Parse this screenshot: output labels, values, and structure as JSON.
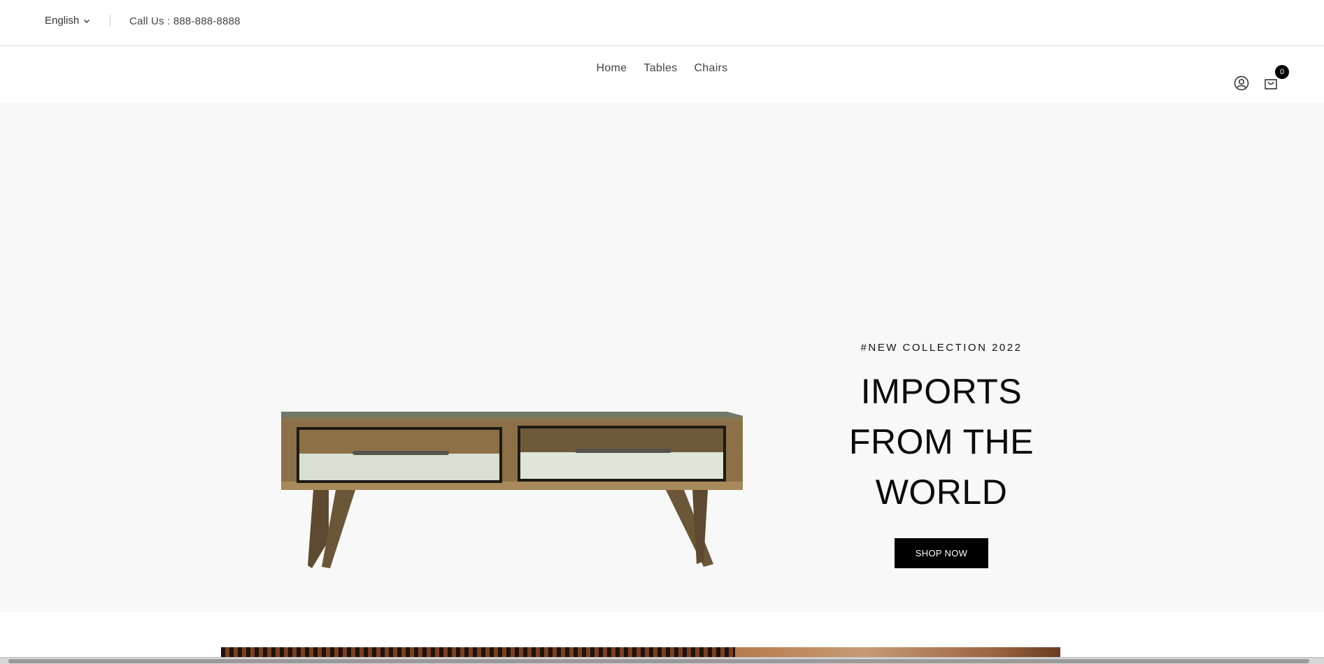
{
  "topbar": {
    "language": "English",
    "phone": "Call Us : 888-888-8888"
  },
  "nav": {
    "items": [
      "Home",
      "Tables",
      "Chairs"
    ]
  },
  "header_icons": {
    "account_icon": "user-circle-icon",
    "cart_icon": "shopping-bag-icon",
    "cart_count": "0"
  },
  "hero": {
    "eyebrow": "#NEW COLLECTION 2022",
    "headline_line1": "IMPORTS",
    "headline_line2": "FROM THE",
    "headline_line3": "WORLD",
    "cta": "SHOP NOW",
    "background": "#f8f8f8",
    "cta_color": "#000000"
  }
}
